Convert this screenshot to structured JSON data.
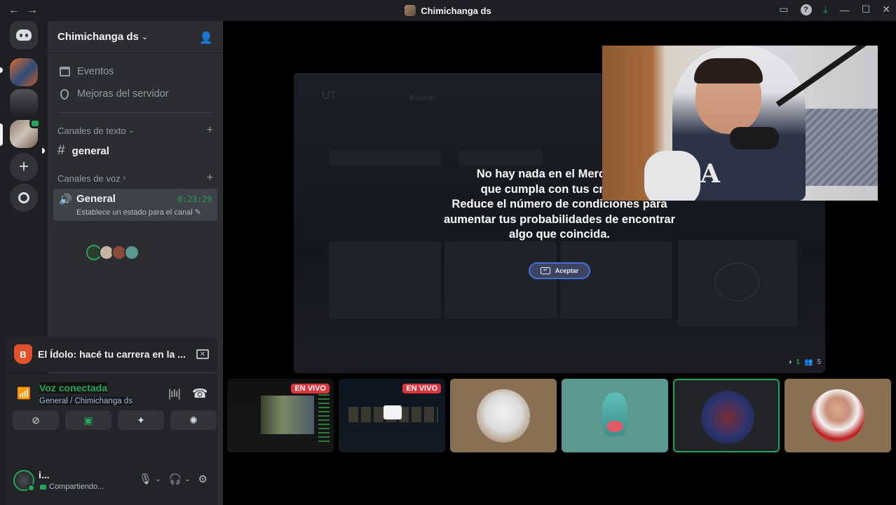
{
  "window": {
    "title": "Chimichanga ds",
    "back_icon": "←",
    "forward_icon": "→"
  },
  "server": {
    "name": "Chimichanga ds",
    "nav": [
      {
        "label": "Eventos",
        "icon": "calendar-icon"
      },
      {
        "label": "Mejoras del servidor",
        "icon": "boost-icon"
      }
    ],
    "text_category": "Canales de texto",
    "text_channels": [
      {
        "name": "general"
      }
    ],
    "voice_category": "Canales de voz",
    "voice_channel": {
      "name": "General",
      "timer": "6:23:29",
      "status": "Establece un estado para el canal"
    }
  },
  "activity": {
    "title": "El Ídolo: hacé tu carrera en la ..."
  },
  "voice_panel": {
    "status": "Voz conectada",
    "location": "General / Chimichanga ds"
  },
  "user": {
    "name": "i...",
    "status": "Compartiendo..."
  },
  "stream": {
    "message": "No hay nada en el Mercado de\nque cumpla con tus criterios\nReduce el número de condiciones para\naumentar tus probabilidades de encontrar\nalgo que coincida.",
    "accept_label": "Aceptar",
    "viewers_a": "1",
    "viewers_b": "5"
  },
  "tiles": [
    {
      "kind": "stream",
      "live_label": "EN VIVO"
    },
    {
      "kind": "stream",
      "live_label": "EN VIVO"
    },
    {
      "kind": "avatar"
    },
    {
      "kind": "avatar"
    },
    {
      "kind": "avatar",
      "selected": true
    },
    {
      "kind": "avatar"
    }
  ],
  "colors": {
    "accent_green": "#23a55a",
    "live_red": "#da373c",
    "sidebar": "#2b2d31",
    "rail": "#1e1f22"
  }
}
